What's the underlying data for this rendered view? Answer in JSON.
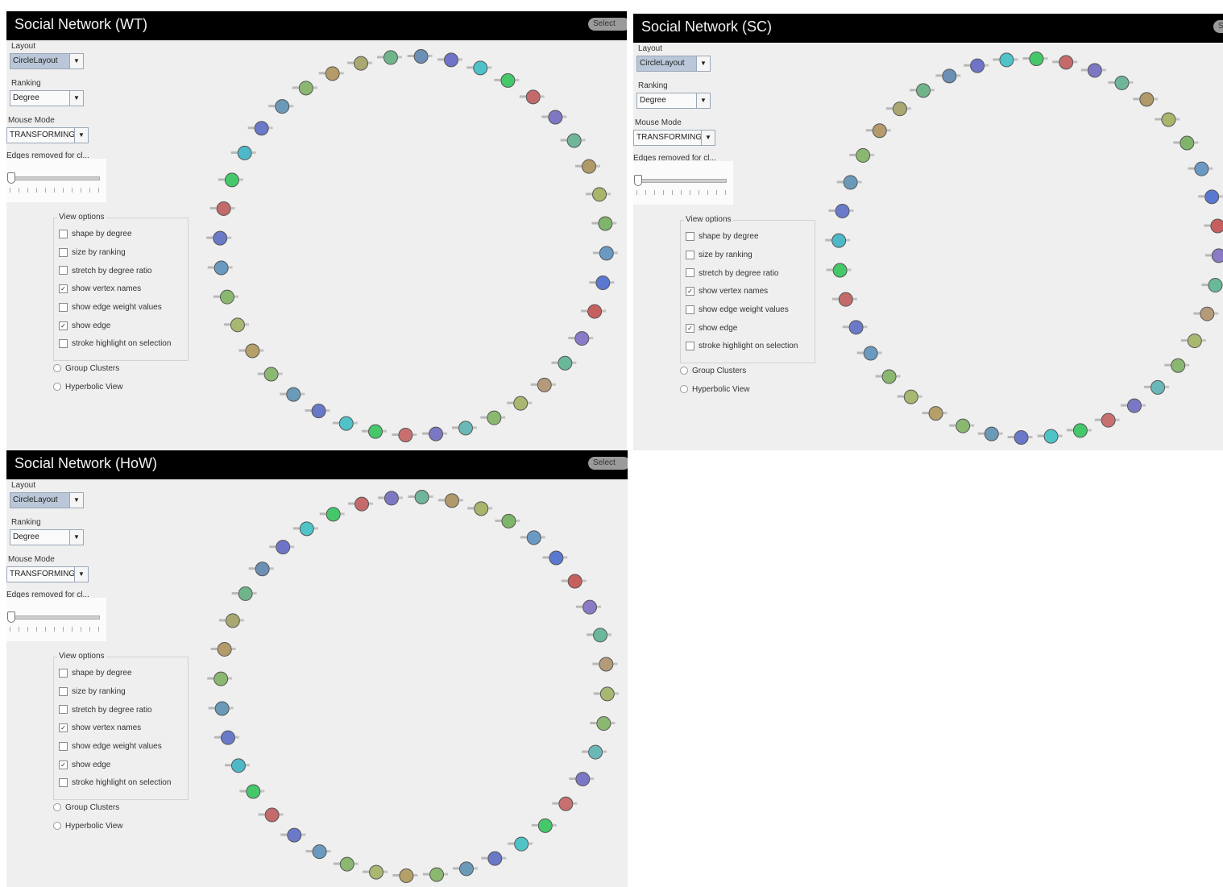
{
  "controls": {
    "layout_label": "Layout",
    "layout_value": "CircleLayout",
    "ranking_label": "Ranking",
    "ranking_value": "Degree",
    "mouse_mode_label": "Mouse Mode",
    "mouse_mode_value": "TRANSFORMING",
    "edges_removed_label": "Edges removed for cl...",
    "select_button": "Select",
    "view_options_title": "View options",
    "view_options": [
      {
        "label": "shape by degree",
        "checked": false
      },
      {
        "label": "size by ranking",
        "checked": false
      },
      {
        "label": "stretch by degree ratio",
        "checked": false
      },
      {
        "label": "show vertex names",
        "checked": true
      },
      {
        "label": "show edge weight values",
        "checked": false
      },
      {
        "label": "show edge",
        "checked": true
      },
      {
        "label": "stroke highlight on selection",
        "checked": false
      }
    ],
    "radios": [
      "Group Clusters",
      "Hyperbolic View"
    ],
    "checkmark": "✓"
  },
  "panels": [
    {
      "title": "Social Network (WT)"
    },
    {
      "title": "Social Network (SC)"
    },
    {
      "title": "Social Network (HoW)"
    }
  ],
  "graph": {
    "node_colors": [
      "#6b8fb5",
      "#6f74c8",
      "#4fc3c8",
      "#45c86a",
      "#c46a6a",
      "#7d77c4",
      "#6fb59a",
      "#b09a6a",
      "#a8b56a",
      "#7fb56a",
      "#6a9ac4",
      "#5a78d0",
      "#c85f5f",
      "#8a7ac8",
      "#6ab89a",
      "#b59a7a",
      "#a8b870",
      "#8ab870",
      "#6ab8b8",
      "#7a78c4",
      "#c87070",
      "#45c86a",
      "#4fc3c8",
      "#6a78c8",
      "#6a9ab8",
      "#8ab870",
      "#b5a06a",
      "#a8b870",
      "#8ab870",
      "#6a9ac0",
      "#6a7ac8",
      "#c46a6a",
      "#45c86a",
      "#4fb8c8",
      "#6a7ac8",
      "#6a9ab8",
      "#8ab870",
      "#b59a6a",
      "#a8a870",
      "#70b58a"
    ]
  }
}
